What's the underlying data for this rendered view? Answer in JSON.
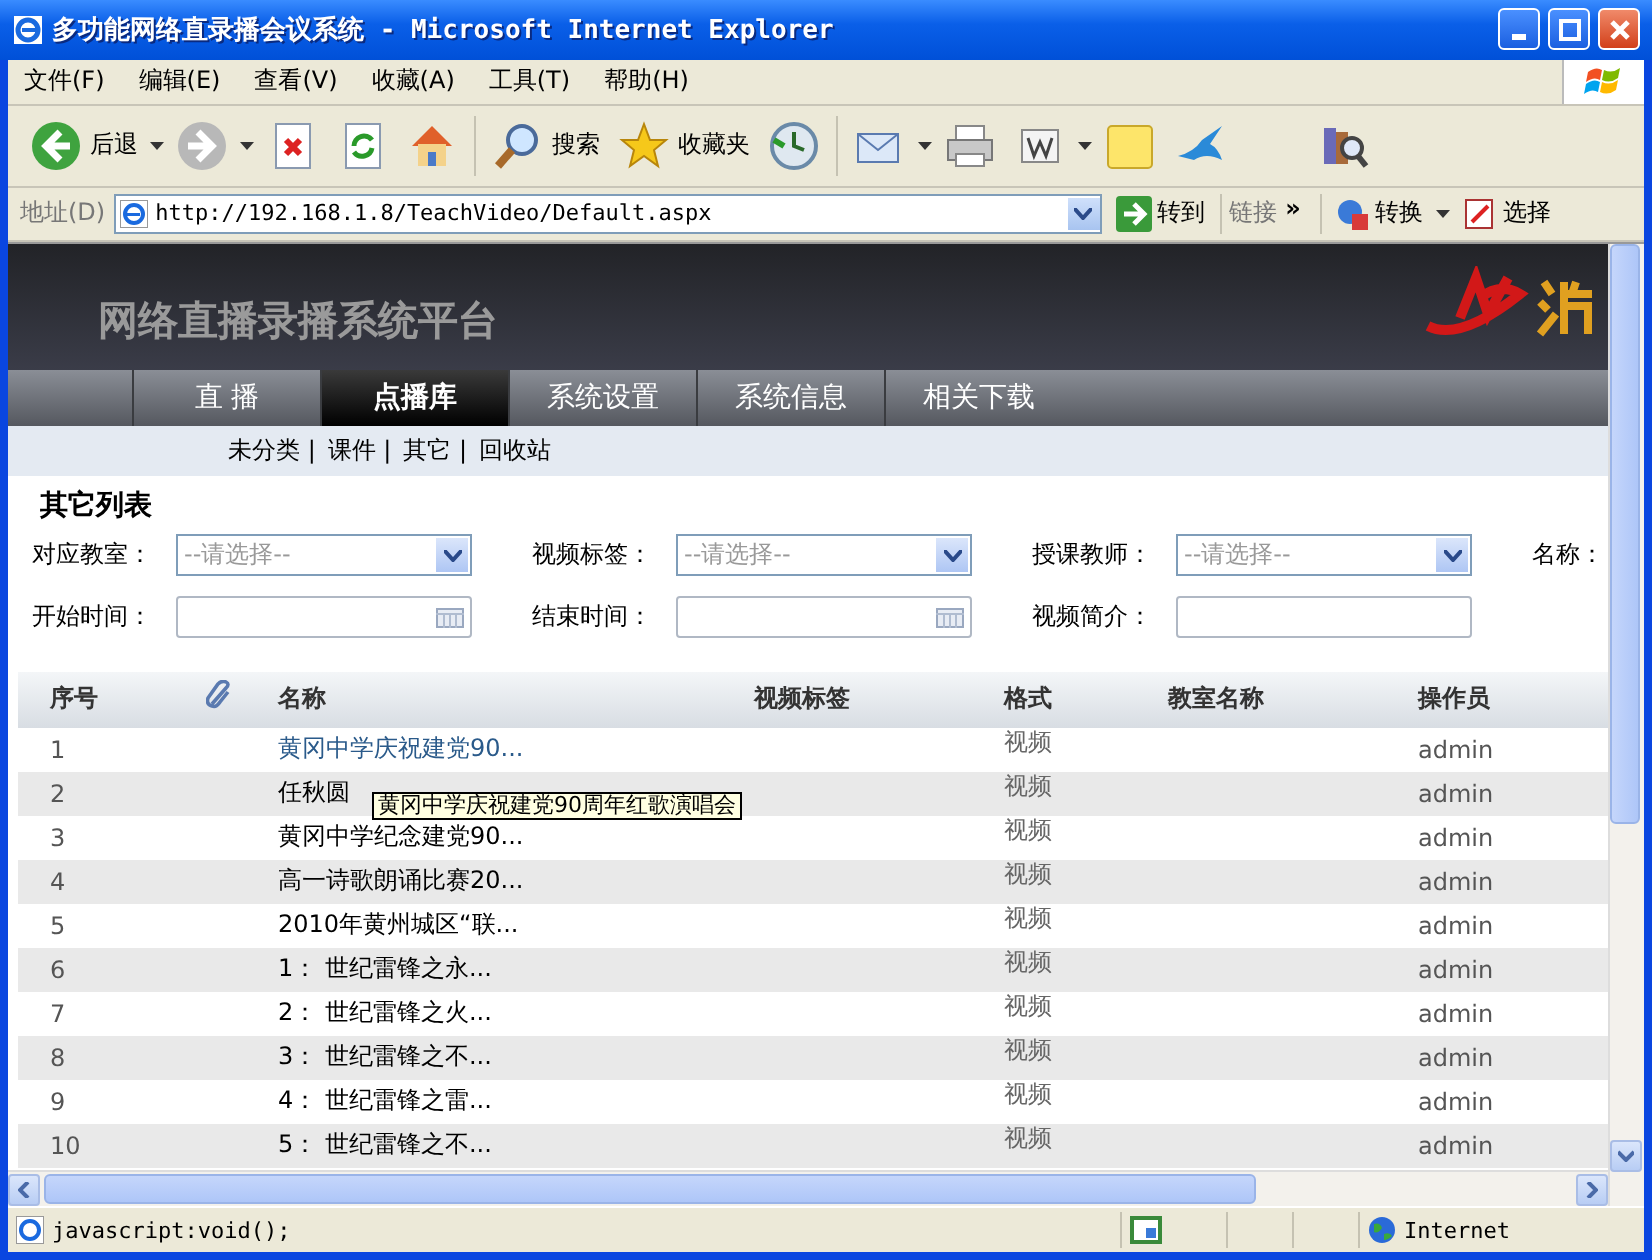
{
  "window": {
    "title": "多功能网络直录播会议系统 - Microsoft Internet Explorer"
  },
  "menu": [
    "文件(F)",
    "编辑(E)",
    "查看(V)",
    "收藏(A)",
    "工具(T)",
    "帮助(H)"
  ],
  "toolbar": [
    {
      "kind": "back",
      "label": "后退"
    },
    {
      "kind": "forward"
    },
    {
      "kind": "stop"
    },
    {
      "kind": "refresh"
    },
    {
      "kind": "home"
    },
    {
      "kind": "search",
      "label": "搜索"
    },
    {
      "kind": "favorites",
      "label": "收藏夹"
    },
    {
      "kind": "history"
    },
    {
      "kind": "mail"
    },
    {
      "kind": "print"
    },
    {
      "kind": "edit"
    },
    {
      "kind": "note"
    },
    {
      "kind": "bird"
    },
    {
      "kind": "research"
    }
  ],
  "address_bar": {
    "label": "地址(D)",
    "url": "http://192.168.1.8/TeachVideo/Default.aspx",
    "go": "转到",
    "links": "链接",
    "more": "»",
    "convert": "转换",
    "select": "选择"
  },
  "site": {
    "title": "网络直播录播系统平台",
    "nav": [
      {
        "label": "直 播",
        "selected": false
      },
      {
        "label": "点播库",
        "selected": true
      },
      {
        "label": "系统设置",
        "selected": false
      },
      {
        "label": "系统信息",
        "selected": false
      },
      {
        "label": "相关下载",
        "selected": false
      }
    ],
    "subnav": [
      "未分类 |",
      "课件 |",
      "其它 |",
      "回收站"
    ],
    "list_title": "其它列表",
    "filters": [
      [
        {
          "label": "对应教室：",
          "kind": "select",
          "value": "--请选择--"
        },
        {
          "label": "视频标签：",
          "kind": "select",
          "value": "--请选择--"
        },
        {
          "label": "授课教师：",
          "kind": "select",
          "value": "--请选择--"
        },
        {
          "label": "名称：",
          "kind": "none"
        }
      ],
      [
        {
          "label": "开始时间：",
          "kind": "date"
        },
        {
          "label": "结束时间：",
          "kind": "date"
        },
        {
          "label": "视频简介：",
          "kind": "text"
        }
      ]
    ]
  },
  "table": {
    "columns": [
      {
        "kind": "text",
        "label": "序号"
      },
      {
        "kind": "attachment"
      },
      {
        "kind": "text",
        "label": "名称"
      },
      {
        "kind": "text",
        "label": "视频标签"
      },
      {
        "kind": "text",
        "label": "格式"
      },
      {
        "kind": "text",
        "label": "教室名称"
      },
      {
        "kind": "text",
        "label": "操作员"
      }
    ],
    "rows": [
      {
        "index": "1",
        "name": "黄冈中学庆祝建党90...",
        "format": "视频",
        "operator": "admin",
        "hovered": true
      },
      {
        "index": "2",
        "name": "任秋圆",
        "format": "视频",
        "operator": "admin",
        "hovered": false
      },
      {
        "index": "3",
        "name": "黄冈中学纪念建党90...",
        "format": "视频",
        "operator": "admin",
        "hovered": false
      },
      {
        "index": "4",
        "name": "高一诗歌朗诵比赛20...",
        "format": "视频",
        "operator": "admin",
        "hovered": false
      },
      {
        "index": "5",
        "name": "2010年黄州城区“联...",
        "format": "视频",
        "operator": "admin",
        "hovered": false
      },
      {
        "index": "6",
        "name": "1： 世纪雷锋之永...",
        "format": "视频",
        "operator": "admin",
        "hovered": false
      },
      {
        "index": "7",
        "name": "2： 世纪雷锋之火...",
        "format": "视频",
        "operator": "admin",
        "hovered": false
      },
      {
        "index": "8",
        "name": "3： 世纪雷锋之不...",
        "format": "视频",
        "operator": "admin",
        "hovered": false
      },
      {
        "index": "9",
        "name": "4： 世纪雷锋之雷...",
        "format": "视频",
        "operator": "admin",
        "hovered": false
      },
      {
        "index": "10",
        "name": "5： 世纪雷锋之不...",
        "format": "视频",
        "operator": "admin",
        "hovered": false
      }
    ],
    "tooltip": "黄冈中学庆祝建党90周年红歌演唱会"
  },
  "status_bar": {
    "text": "javascript:void();",
    "zone": "Internet"
  }
}
